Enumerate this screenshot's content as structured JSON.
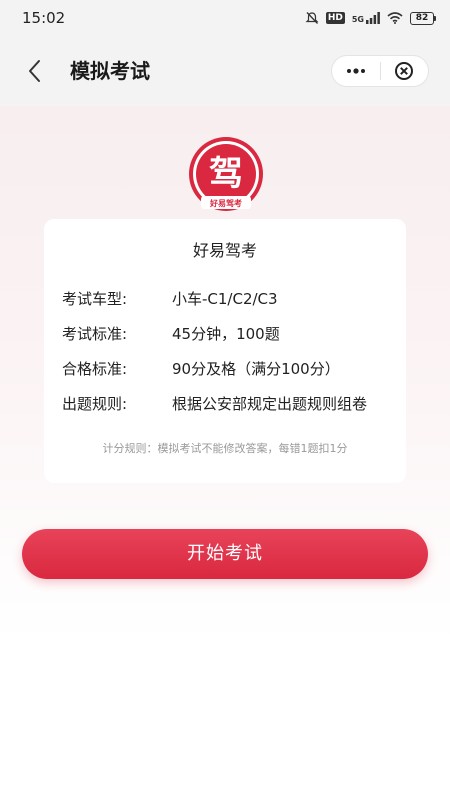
{
  "status_bar": {
    "time": "15:02",
    "network": "HD",
    "signal": "5G",
    "battery": "82"
  },
  "nav": {
    "title": "模拟考试",
    "back_icon": "chevron-left-icon",
    "more_icon": "more-dots-icon",
    "close_icon": "close-circle-icon"
  },
  "logo": {
    "glyph": "驾",
    "text": "好易驾考",
    "color": "#d9283f"
  },
  "card": {
    "title": "好易驾考",
    "rows": [
      {
        "label": "考试车型:",
        "value": "小车-C1/C2/C3"
      },
      {
        "label": "考试标准:",
        "value": "45分钟，100题"
      },
      {
        "label": "合格标准:",
        "value": "90分及格（满分100分）"
      },
      {
        "label": "出题规则:",
        "value": "根据公安部规定出题规则组卷"
      }
    ],
    "scoring_note": "计分规则：模拟考试不能修改答案，每错1题扣1分"
  },
  "start_button": {
    "label": "开始考试",
    "color": "#d9283f"
  }
}
